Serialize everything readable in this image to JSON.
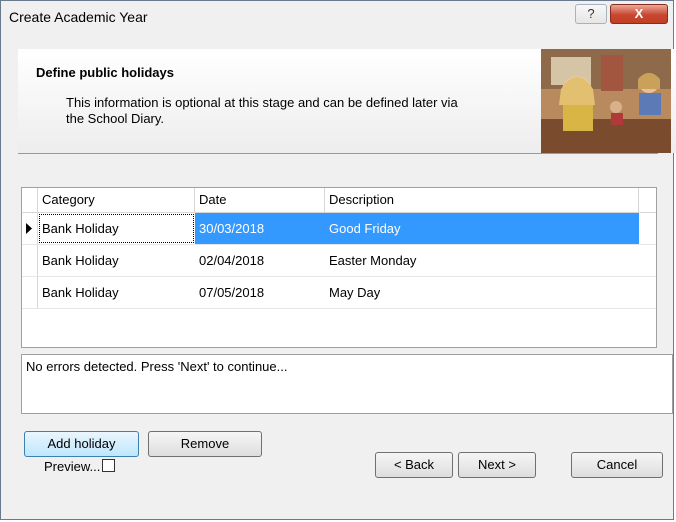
{
  "window": {
    "title": "Create Academic Year",
    "help_label": "?",
    "close_label": "X"
  },
  "header": {
    "title": "Define public holidays",
    "description": "This information is optional at this stage and can be defined later via the School Diary."
  },
  "grid": {
    "columns": [
      "Category",
      "Date",
      "Description"
    ],
    "rows": [
      {
        "category": "Bank Holiday",
        "date": "30/03/2018",
        "description": "Good Friday"
      },
      {
        "category": "Bank Holiday",
        "date": "02/04/2018",
        "description": "Easter Monday"
      },
      {
        "category": "Bank Holiday",
        "date": "07/05/2018",
        "description": "May Day"
      }
    ]
  },
  "message": "No errors detected. Press 'Next' to continue...",
  "actions": {
    "add_label": "Add holiday",
    "remove_label": "Remove"
  },
  "footer": {
    "preview_label": "Preview...",
    "back_label": "< Back",
    "next_label": "Next >",
    "cancel_label": "Cancel"
  },
  "colors": {
    "selection": "#3399ff",
    "close": "#c9462f"
  }
}
